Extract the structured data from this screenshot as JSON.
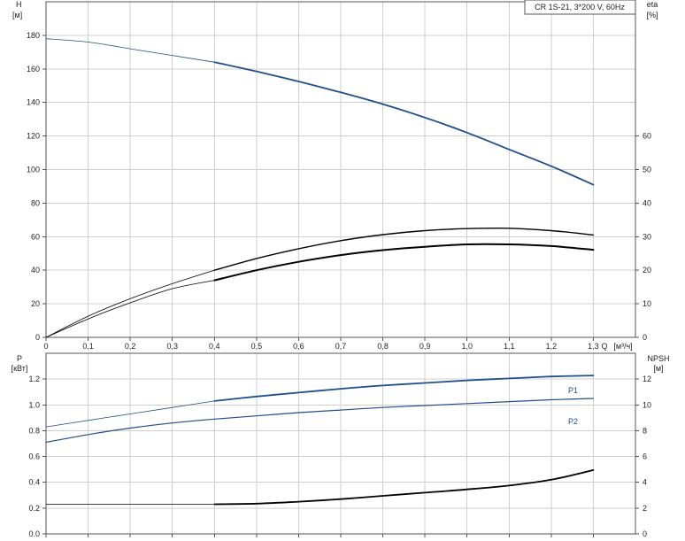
{
  "chart_data": [
    {
      "type": "line",
      "title": "CR 1S-21, 3*200 V, 60Hz",
      "xlabel": "Q [м³/ч]",
      "xlabel_q": "Q",
      "xlabel_unit": "[м³/ч]",
      "xlim": [
        0,
        1.4
      ],
      "x_ticks": [
        "0",
        "0,1",
        "0,2",
        "0,3",
        "0,4",
        "0,5",
        "0,6",
        "0,7",
        "0,8",
        "0,9",
        "1,0",
        "1,1",
        "1,2",
        "1,3"
      ],
      "ylabel_left": "H",
      "ylabel_left_unit": "[м]",
      "ylim_left": [
        0,
        200
      ],
      "y_left_ticks": [
        0,
        20,
        40,
        60,
        80,
        100,
        120,
        140,
        160,
        180
      ],
      "ylabel_right": "eta",
      "ylabel_right_unit": "[%]",
      "ylim_right": [
        0,
        100
      ],
      "y_right_ticks": [
        0,
        10,
        20,
        30,
        40,
        50,
        60
      ],
      "grid": true,
      "series": [
        {
          "axis": "left",
          "color": "#1f4e8c",
          "width": 1.8,
          "extrapolated_until": 0.4,
          "x": [
            0,
            0.1,
            0.2,
            0.3,
            0.4,
            0.5,
            0.6,
            0.7,
            0.8,
            0.9,
            1.0,
            1.1,
            1.2,
            1.3
          ],
          "y": [
            178,
            176,
            172,
            168,
            164,
            158.5,
            152.5,
            146,
            139,
            131,
            122,
            112,
            102,
            91
          ]
        },
        {
          "axis": "right",
          "color": "#000000",
          "width": 1.4,
          "extrapolated_until": 0.4,
          "x": [
            0,
            0.1,
            0.2,
            0.3,
            0.4,
            0.5,
            0.6,
            0.7,
            0.8,
            0.9,
            1.0,
            1.1,
            1.2,
            1.3
          ],
          "y": [
            0,
            6.3,
            11.5,
            16,
            20,
            23.5,
            26.4,
            28.8,
            30.6,
            31.8,
            32.4,
            32.5,
            31.8,
            30.5
          ]
        },
        {
          "axis": "right",
          "color": "#000000",
          "width": 2.0,
          "extrapolated_until": 0.4,
          "x": [
            0,
            0.1,
            0.2,
            0.3,
            0.4,
            0.5,
            0.6,
            0.7,
            0.8,
            0.9,
            1.0,
            1.1,
            1.2,
            1.3
          ],
          "y": [
            0,
            5.5,
            10.3,
            14.5,
            17,
            20,
            22.5,
            24.5,
            26,
            27,
            27.7,
            27.7,
            27.2,
            26.1
          ]
        }
      ]
    },
    {
      "type": "line",
      "xlim": [
        0,
        1.4
      ],
      "ylabel_left": "P",
      "ylabel_left_unit": "[кВт]",
      "ylim_left": [
        0,
        1.4
      ],
      "y_left_ticks": [
        "0.0",
        "0.2",
        "0.4",
        "0.6",
        "0.8",
        "1.0",
        "1.2"
      ],
      "ylabel_right": "NPSH",
      "ylabel_right_unit": "[м]",
      "ylim_right": [
        0,
        14
      ],
      "y_right_ticks": [
        0,
        2,
        4,
        6,
        8,
        10,
        12
      ],
      "grid": true,
      "series": [
        {
          "name": "P1",
          "axis": "left",
          "color": "#1f4e8c",
          "width": 1.8,
          "extrapolated_until": 0.4,
          "x": [
            0,
            0.1,
            0.2,
            0.3,
            0.4,
            0.5,
            0.6,
            0.7,
            0.8,
            0.9,
            1.0,
            1.1,
            1.2,
            1.3
          ],
          "y": [
            0.83,
            0.88,
            0.93,
            0.98,
            1.03,
            1.065,
            1.095,
            1.125,
            1.15,
            1.17,
            1.19,
            1.205,
            1.22,
            1.228
          ]
        },
        {
          "name": "P2",
          "axis": "left",
          "color": "#1f4e8c",
          "width": 1.2,
          "extrapolated_until": 0,
          "x": [
            0,
            0.1,
            0.2,
            0.3,
            0.4,
            0.5,
            0.6,
            0.7,
            0.8,
            0.9,
            1.0,
            1.1,
            1.2,
            1.3
          ],
          "y": [
            0.71,
            0.77,
            0.82,
            0.86,
            0.89,
            0.915,
            0.94,
            0.96,
            0.98,
            0.995,
            1.01,
            1.025,
            1.04,
            1.05
          ]
        },
        {
          "axis": "right",
          "color": "#000000",
          "width": 1.8,
          "extrapolated_until": 0.4,
          "x": [
            0,
            0.1,
            0.2,
            0.3,
            0.4,
            0.5,
            0.6,
            0.7,
            0.8,
            0.9,
            1.0,
            1.1,
            1.2,
            1.3
          ],
          "y": [
            2.3,
            2.3,
            2.3,
            2.3,
            2.3,
            2.35,
            2.5,
            2.7,
            2.95,
            3.2,
            3.45,
            3.75,
            4.2,
            4.95
          ]
        }
      ]
    }
  ]
}
